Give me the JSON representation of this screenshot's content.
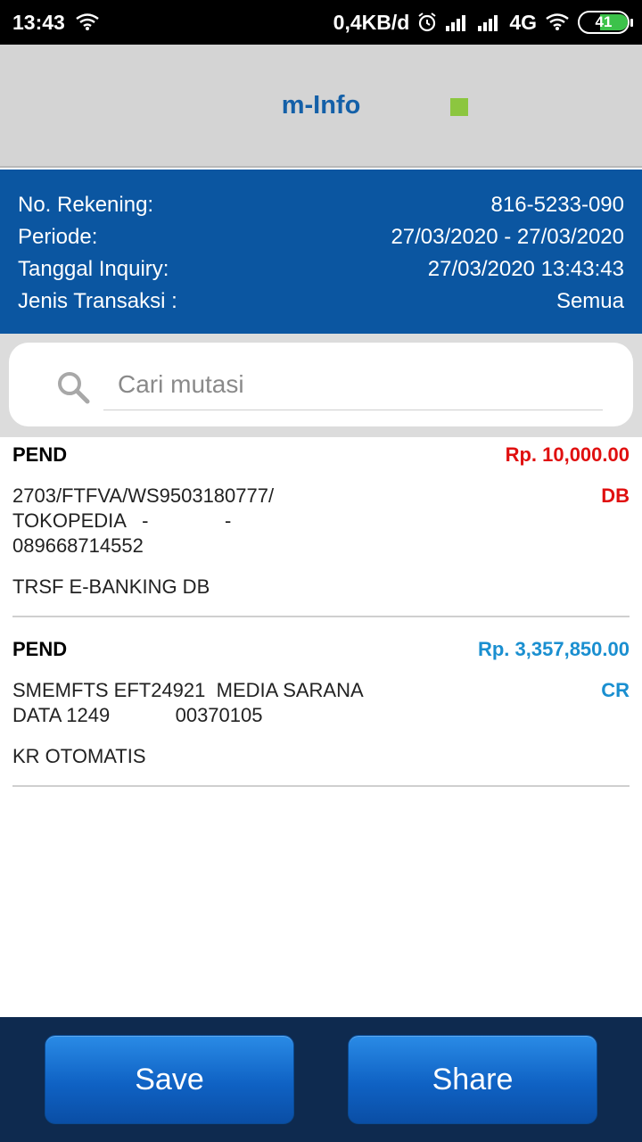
{
  "status_bar": {
    "time": "13:43",
    "speed": "0,4KB/d",
    "network": "4G",
    "battery": "41"
  },
  "header": {
    "title": "m-Info"
  },
  "account": {
    "rows": [
      {
        "label": "No. Rekening:",
        "value": "816-5233-090"
      },
      {
        "label": "Periode:",
        "value": "27/03/2020 - 27/03/2020"
      },
      {
        "label": "Tanggal Inquiry:",
        "value": "27/03/2020 13:43:43"
      },
      {
        "label": "Jenis Transaksi :",
        "value": "Semua"
      }
    ]
  },
  "search": {
    "placeholder": "Cari mutasi"
  },
  "transactions": [
    {
      "status": "PEND",
      "amount": "Rp. 10,000.00",
      "description": "2703/FTFVA/WS9503180777/\nTOKOPEDIA   -              -\n089668714552",
      "type": "DB",
      "note": "TRSF E-BANKING DB"
    },
    {
      "status": "PEND",
      "amount": "Rp. 3,357,850.00",
      "description": "SMEMFTS EFT24921  MEDIA SARANA\nDATA 1249            00370105",
      "type": "CR",
      "note": "KR OTOMATIS"
    }
  ],
  "buttons": {
    "save": "Save",
    "share": "Share"
  },
  "colors": {
    "debit": "#e01010",
    "credit": "#1a8fd0",
    "info_panel": "#0b56a1",
    "indicator": "#8cc63f"
  }
}
